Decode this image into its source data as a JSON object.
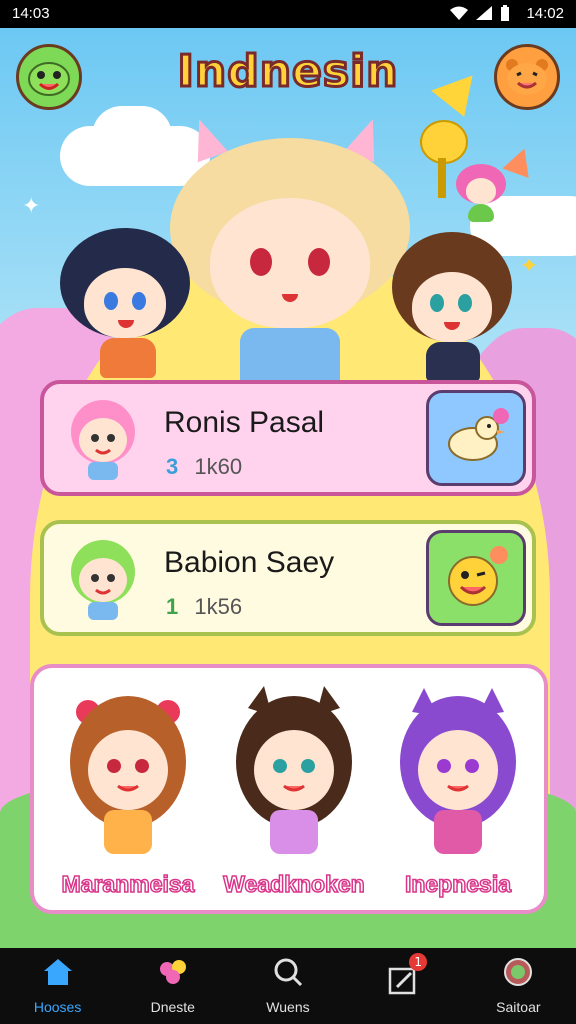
{
  "status_bar": {
    "time_left": "14:03",
    "time_right": "14:02",
    "icons": [
      "wifi-icon",
      "signal-icon",
      "battery-icon"
    ]
  },
  "header": {
    "title": "Indnesin",
    "left_icon": "frog-face-icon",
    "right_icon": "bear-face-icon"
  },
  "cards": [
    {
      "title": "Ronis Pasal",
      "count": "3",
      "value": "1k60",
      "action_icon": "duck-icon"
    },
    {
      "title": "Babion Saey",
      "count": "1",
      "value": "1k56",
      "action_icon": "smiley-icon"
    }
  ],
  "characters": [
    {
      "name": "Maranmeisa"
    },
    {
      "name": "Weadknoken"
    },
    {
      "name": "Inepnesia"
    }
  ],
  "bottom_nav": [
    {
      "label": "Hooses",
      "icon": "home-icon",
      "active": true
    },
    {
      "label": "Dneste",
      "icon": "flower-icon",
      "active": false
    },
    {
      "label": "Wuens",
      "icon": "search-icon",
      "active": false
    },
    {
      "label": "",
      "icon": "edit-icon",
      "active": false,
      "badge": "1"
    },
    {
      "label": "Saitoar",
      "icon": "compass-icon",
      "active": false
    }
  ],
  "colors": {
    "accent": "#3aa7ff",
    "title_fill": "#ffd23a",
    "card_pink": "#ffd3ee",
    "card_cream": "#fffbe0",
    "panel_border": "#e88dc7"
  }
}
